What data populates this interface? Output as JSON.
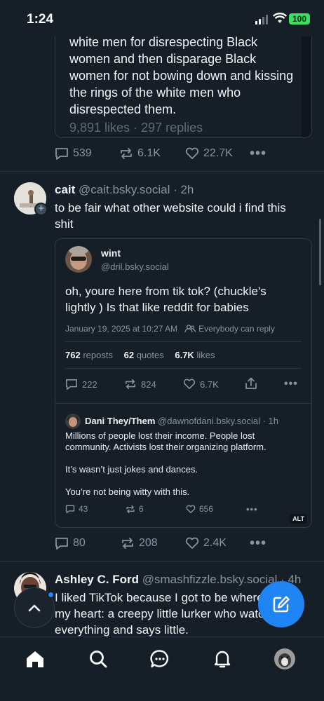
{
  "status_bar": {
    "time": "1:24",
    "battery": "100"
  },
  "top_quote": {
    "text": "white men for disrespecting Black women and then disparage Black women for not bowing down and kissing the rings of the white men who disrespected them.",
    "meta": "9,891 likes · 297 replies"
  },
  "post1_actions": {
    "replies": "539",
    "reposts": "6.1K",
    "likes": "22.7K",
    "more": "•••"
  },
  "post2": {
    "name": "cait",
    "handle": "@cait.bsky.social · 2h",
    "text": "to be fair what other website could i find this shit",
    "quote": {
      "name": "wint",
      "handle": "@dril.bsky.social",
      "text": "oh, youre here from tik tok?  (chuckle's lightly ) Is that like reddit for babies",
      "date": "January 19, 2025 at 10:27 AM",
      "reply_setting": "Everybody can reply",
      "reposts_count": "762",
      "reposts_label": "reposts",
      "quotes_count": "62",
      "quotes_label": "quotes",
      "likes_count": "6.7K",
      "likes_label": "likes",
      "actions": {
        "replies": "222",
        "reposts": "824",
        "likes": "6.7K",
        "more": "•••"
      },
      "nested": {
        "name": "Dani They/Them",
        "handle": "@dawnofdani.bsky.social · 1h",
        "p1": "Millions of people lost their income. People lost community. Activists lost their organizing platform.",
        "p2": "It’s wasn’t just jokes and dances.",
        "p3": "You’re not being witty with this.",
        "actions": {
          "replies": "43",
          "reposts": "6",
          "likes": "656",
          "more": "•••"
        },
        "alt": "ALT"
      }
    },
    "actions": {
      "replies": "80",
      "reposts": "208",
      "likes": "2.4K",
      "more": "•••"
    }
  },
  "post3": {
    "name": "Ashley C. Ford",
    "handle": "@smashfizzle.bsky.social · 4h",
    "text": "I liked TikTok because I got to be where I am in my heart: a creepy little lurker who watches everything and says little."
  },
  "colors": {
    "background": "#161e27",
    "accent": "#1f84f4",
    "muted": "#8793a1",
    "border": "#2e3a47"
  },
  "nav": [
    "home-icon",
    "search-icon",
    "chat-icon",
    "bell-icon",
    "profile-avatar"
  ]
}
